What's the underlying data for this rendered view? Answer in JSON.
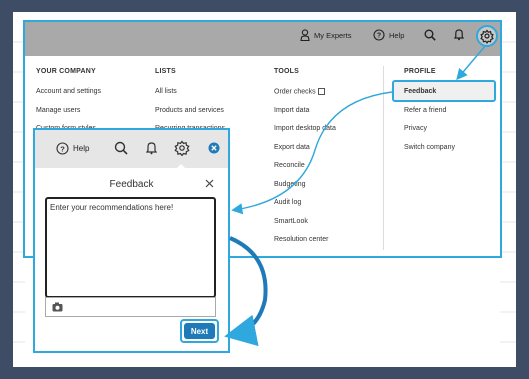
{
  "header": {
    "my_experts": "My Experts",
    "help": "Help"
  },
  "menu": {
    "your_company": {
      "heading": "YOUR COMPANY",
      "items": [
        "Account and settings",
        "Manage users",
        "Custom form styles"
      ]
    },
    "lists": {
      "heading": "LISTS",
      "items": [
        "All lists",
        "Products and services",
        "Recurring transactions"
      ]
    },
    "tools": {
      "heading": "TOOLS",
      "items": [
        "Order checks",
        "Import data",
        "Import desktop data",
        "Export data",
        "Reconcile",
        "Budgeting",
        "Audit log",
        "SmartLook",
        "Resolution center"
      ]
    },
    "profile": {
      "heading": "PROFILE",
      "items": [
        "Feedback",
        "Refer a friend",
        "Privacy",
        "Switch company"
      ]
    }
  },
  "panel": {
    "help": "Help",
    "title": "Feedback",
    "textarea_placeholder": "Enter your recommendations here!",
    "next_label": "Next"
  },
  "colors": {
    "accent": "#2ea8dd",
    "next_button": "#1e7ab8",
    "topbar": "#a9a9a9",
    "frame": "#3e4c66"
  }
}
